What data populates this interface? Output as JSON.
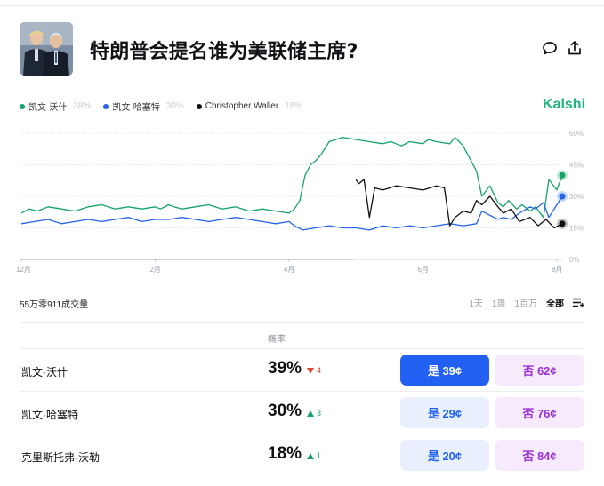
{
  "header": {
    "title": "特朗普会提名谁为美联储主席?"
  },
  "legend": [
    {
      "name": "凯文·沃什",
      "pct": "38%",
      "color": "#16a36b"
    },
    {
      "name": "凯文·哈塞特",
      "pct": "30%",
      "color": "#2563eb"
    },
    {
      "name": "Christopher Waller",
      "pct": "18%",
      "color": "#111111"
    }
  ],
  "brand": "Kalshi",
  "chart_data": {
    "type": "line",
    "x_ticks": [
      "12月",
      "2月",
      "4月",
      "6月",
      "8月"
    ],
    "y_ticks": [
      "60%",
      "45%",
      "30%",
      "15%",
      "0%"
    ],
    "ylim": [
      0,
      60
    ],
    "y_axis_side": "right",
    "grid": true,
    "series": [
      {
        "name": "凯文·沃什",
        "color": "#16a36b",
        "x": [
          0,
          0.03,
          0.06,
          0.1,
          0.15,
          0.2,
          0.25,
          0.3,
          0.35,
          0.4,
          0.45,
          0.5,
          0.52,
          0.55,
          0.57,
          0.6,
          0.65,
          0.7,
          0.75,
          0.8,
          0.85,
          0.9,
          0.95,
          1.0,
          1.02,
          1.04,
          1.06,
          1.08,
          1.1,
          1.12,
          1.15,
          1.2,
          1.25,
          1.3,
          1.35,
          1.38,
          1.4,
          1.42,
          1.45,
          1.5,
          1.52,
          1.55,
          1.6,
          1.62,
          1.65,
          1.7,
          1.72,
          1.75,
          1.78,
          1.8,
          1.82,
          1.85,
          1.87,
          1.9,
          1.92,
          1.95,
          1.97,
          2.0,
          2.02
        ],
        "values": [
          22,
          24,
          23,
          25,
          24,
          23,
          25,
          26,
          24,
          25,
          24,
          25,
          24,
          26,
          25,
          24,
          25,
          26,
          24,
          25,
          23,
          24,
          23,
          22,
          24,
          28,
          40,
          45,
          47,
          50,
          56,
          58,
          57,
          56,
          55,
          56,
          55,
          54,
          56,
          55,
          57,
          56,
          55,
          58,
          54,
          42,
          30,
          35,
          27,
          25,
          28,
          24,
          26,
          23,
          25,
          20,
          38,
          33,
          40
        ]
      },
      {
        "name": "凯文·哈塞特",
        "color": "#2563eb",
        "x": [
          0,
          0.05,
          0.1,
          0.15,
          0.2,
          0.25,
          0.3,
          0.35,
          0.4,
          0.45,
          0.5,
          0.55,
          0.6,
          0.65,
          0.7,
          0.75,
          0.8,
          0.85,
          0.9,
          0.95,
          1.0,
          1.02,
          1.05,
          1.1,
          1.15,
          1.2,
          1.25,
          1.3,
          1.35,
          1.4,
          1.45,
          1.5,
          1.55,
          1.6,
          1.65,
          1.7,
          1.72,
          1.75,
          1.78,
          1.8,
          1.83,
          1.86,
          1.9,
          1.92,
          1.95,
          1.97,
          2.0,
          2.02
        ],
        "values": [
          17,
          18,
          19,
          17,
          18,
          19,
          18,
          19,
          20,
          18,
          19,
          19,
          20,
          19,
          18,
          19,
          20,
          19,
          18,
          17,
          18,
          16,
          14,
          15,
          16,
          15,
          15,
          14,
          16,
          15,
          16,
          15,
          16,
          17,
          16,
          17,
          23,
          21,
          19,
          20,
          19,
          22,
          25,
          24,
          27,
          20,
          26,
          30
        ]
      },
      {
        "name": "Christopher Waller",
        "color": "#111111",
        "x": [
          1.25,
          1.26,
          1.28,
          1.3,
          1.32,
          1.35,
          1.4,
          1.45,
          1.5,
          1.55,
          1.58,
          1.6,
          1.62,
          1.65,
          1.68,
          1.7,
          1.72,
          1.75,
          1.78,
          1.8,
          1.83,
          1.86,
          1.9,
          1.93,
          1.96,
          1.99,
          2.02
        ],
        "values": [
          38,
          36,
          38,
          20,
          34,
          33,
          35,
          34,
          33,
          35,
          34,
          16,
          20,
          23,
          22,
          28,
          26,
          30,
          25,
          22,
          24,
          18,
          20,
          16,
          19,
          15,
          17
        ]
      }
    ]
  },
  "volume": "55万零911成交量",
  "ranges": [
    "1天",
    "1周",
    "1百万",
    "全部"
  ],
  "active_range": "全部",
  "table": {
    "probability_header": "概率",
    "rows": [
      {
        "name": "凯文·沃什",
        "prob": "39%",
        "delta": "4",
        "direction": "down",
        "yes": "是 39¢",
        "no": "否 62¢",
        "primary": true
      },
      {
        "name": "凯文·哈塞特",
        "prob": "30%",
        "delta": "3",
        "direction": "up",
        "yes": "是 29¢",
        "no": "否 76¢",
        "primary": false
      },
      {
        "name": "克里斯托弗·沃勒",
        "prob": "18%",
        "delta": "1",
        "direction": "up",
        "yes": "是 20¢",
        "no": "否 84¢",
        "primary": false
      }
    ]
  },
  "icons": {
    "comment": "comment-icon",
    "share": "share-icon"
  }
}
